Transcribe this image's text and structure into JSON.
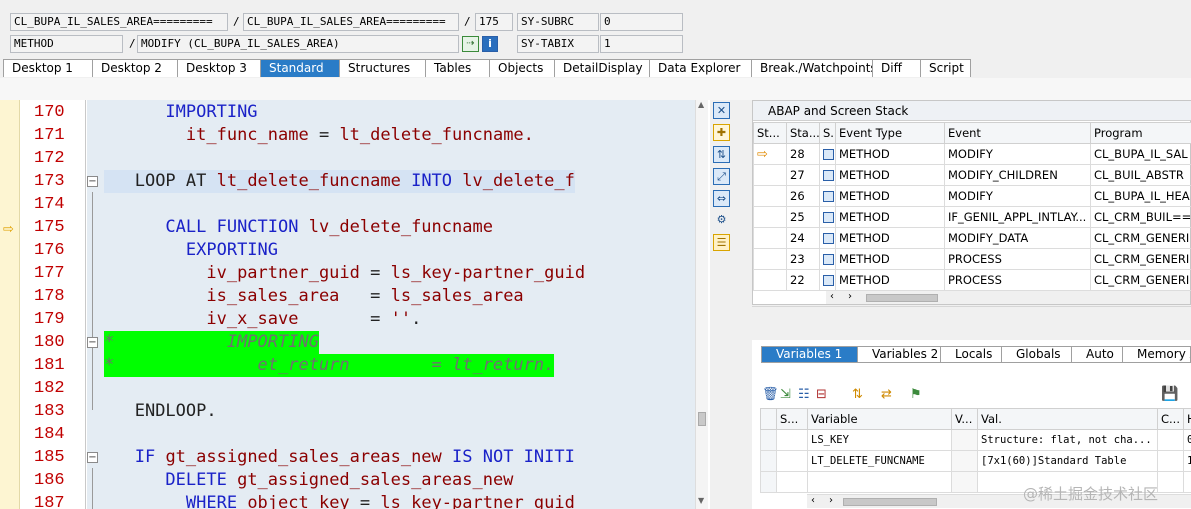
{
  "header": {
    "row1": {
      "field1": "CL_BUPA_IL_SALES_AREA=========",
      "sep1": "/",
      "field2": "CL_BUPA_IL_SALES_AREA=========",
      "sep2": "/",
      "line": "175",
      "var": "SY-SUBRC",
      "val": "0"
    },
    "row2": {
      "field1": "METHOD",
      "sep1": "/",
      "field2": "MODIFY (CL_BUPA_IL_SALES_AREA)",
      "var": "SY-TABIX",
      "val": "1"
    }
  },
  "tabs": [
    "Desktop 1",
    "Desktop 2",
    "Desktop 3",
    "Standard",
    "Structures",
    "Tables",
    "Objects",
    "DetailDisplay",
    "Data Explorer",
    "Break./Watchpoints",
    "Diff",
    "Script"
  ],
  "active_tab": "Standard",
  "editor": {
    "lines": [
      {
        "n": "170",
        "segs": [
          {
            "t": "  IMPORTING",
            "c": "kw"
          }
        ]
      },
      {
        "n": "171",
        "segs": [
          {
            "t": "    it_func_name ",
            "c": "id"
          },
          {
            "t": "= ",
            "c": "pl"
          },
          {
            "t": "lt_delete_funcname.",
            "c": "id"
          }
        ]
      },
      {
        "n": "172",
        "segs": []
      },
      {
        "n": "173",
        "segs": [
          {
            "t": "LOOP AT ",
            "c": "pl"
          },
          {
            "t": "lt_delete_funcname ",
            "c": "id"
          },
          {
            "t": "INTO ",
            "c": "kw"
          },
          {
            "t": "lv_delete_f",
            "c": "id"
          }
        ]
      },
      {
        "n": "174",
        "segs": []
      },
      {
        "n": "175",
        "segs": [
          {
            "t": "  CALL FUNCTION ",
            "c": "kw"
          },
          {
            "t": "lv_delete_funcname",
            "c": "id"
          }
        ]
      },
      {
        "n": "176",
        "segs": [
          {
            "t": "    EXPORTING",
            "c": "kw"
          }
        ]
      },
      {
        "n": "177",
        "segs": [
          {
            "t": "      iv_partner_guid ",
            "c": "id"
          },
          {
            "t": "= ",
            "c": "pl"
          },
          {
            "t": "ls_key-partner_guid",
            "c": "id"
          }
        ]
      },
      {
        "n": "178",
        "segs": [
          {
            "t": "      is_sales_area   ",
            "c": "id"
          },
          {
            "t": "= ",
            "c": "pl"
          },
          {
            "t": "ls_sales_area",
            "c": "id"
          }
        ]
      },
      {
        "n": "179",
        "segs": [
          {
            "t": "      iv_x_save       ",
            "c": "id"
          },
          {
            "t": "= ",
            "c": "pl"
          },
          {
            "t": "''",
            "c": "id"
          },
          {
            "t": ".",
            "c": "pl"
          }
        ]
      },
      {
        "n": "180",
        "segs": [
          {
            "t": "*           IMPORTING",
            "c": "cmt"
          }
        ]
      },
      {
        "n": "181",
        "segs": [
          {
            "t": "*              et_return        = lt_return.",
            "c": "cmt"
          }
        ]
      },
      {
        "n": "182",
        "segs": []
      },
      {
        "n": "183",
        "segs": [
          {
            "t": "ENDLOOP.",
            "c": "pl"
          }
        ]
      },
      {
        "n": "184",
        "segs": []
      },
      {
        "n": "185",
        "segs": [
          {
            "t": "IF ",
            "c": "kw"
          },
          {
            "t": "gt_assigned_sales_areas_new ",
            "c": "id"
          },
          {
            "t": "IS NOT INITI",
            "c": "kw"
          }
        ]
      },
      {
        "n": "186",
        "segs": [
          {
            "t": "  DELETE ",
            "c": "kw"
          },
          {
            "t": "gt_assigned_sales_areas_new",
            "c": "id"
          }
        ]
      },
      {
        "n": "187",
        "segs": [
          {
            "t": "    WHERE ",
            "c": "kw"
          },
          {
            "t": "object_key ",
            "c": "id"
          },
          {
            "t": "= ",
            "c": "pl"
          },
          {
            "t": "ls_key-partner_guid",
            "c": "id"
          }
        ]
      }
    ]
  },
  "stack": {
    "title": "ABAP and Screen Stack",
    "headers": [
      "St...",
      "Sta...",
      "S...",
      "Event Type",
      "Event",
      "Program"
    ],
    "rows": [
      {
        "step": "28",
        "type": "METHOD",
        "event": "MODIFY",
        "program": "CL_BUPA_IL_SAL"
      },
      {
        "step": "27",
        "type": "METHOD",
        "event": "MODIFY_CHILDREN",
        "program": "CL_BUIL_ABSTR"
      },
      {
        "step": "26",
        "type": "METHOD",
        "event": "MODIFY",
        "program": "CL_BUPA_IL_HEA"
      },
      {
        "step": "25",
        "type": "METHOD",
        "event": "IF_GENIL_APPL_INTLAY...",
        "program": "CL_CRM_BUIL=="
      },
      {
        "step": "24",
        "type": "METHOD",
        "event": "MODIFY_DATA",
        "program": "CL_CRM_GENERI"
      },
      {
        "step": "23",
        "type": "METHOD",
        "event": "PROCESS",
        "program": "CL_CRM_GENERI"
      },
      {
        "step": "22",
        "type": "METHOD",
        "event": "PROCESS",
        "program": "CL_CRM_GENERI"
      }
    ]
  },
  "vars": {
    "tabs": [
      "Variables 1",
      "Variables 2",
      "Locals",
      "Globals",
      "Auto",
      "Memory A"
    ],
    "headers": [
      "S...",
      "Variable",
      "V...",
      "Val.",
      "C...",
      "H"
    ],
    "rows": [
      {
        "name": "LS_KEY",
        "value": "Structure: flat, not cha...",
        "h": "0"
      },
      {
        "name": "LT_DELETE_FUNCNAME",
        "value": "[7x1(60)]Standard Table",
        "h": "1"
      }
    ]
  },
  "watermark": "@稀土掘金技术社区"
}
